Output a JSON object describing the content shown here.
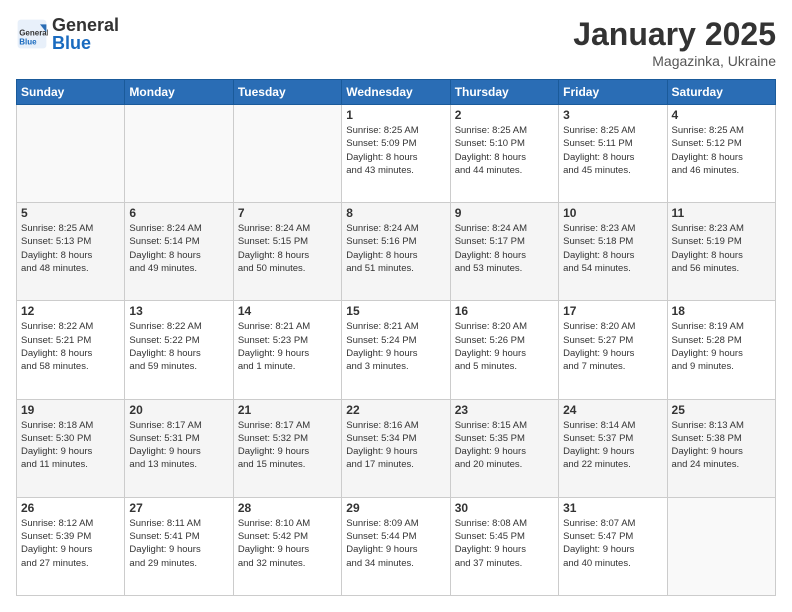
{
  "logo": {
    "general": "General",
    "blue": "Blue"
  },
  "title": "January 2025",
  "location": "Magazinka, Ukraine",
  "days_header": [
    "Sunday",
    "Monday",
    "Tuesday",
    "Wednesday",
    "Thursday",
    "Friday",
    "Saturday"
  ],
  "weeks": [
    [
      {
        "day": "",
        "info": ""
      },
      {
        "day": "",
        "info": ""
      },
      {
        "day": "",
        "info": ""
      },
      {
        "day": "1",
        "info": "Sunrise: 8:25 AM\nSunset: 5:09 PM\nDaylight: 8 hours\nand 43 minutes."
      },
      {
        "day": "2",
        "info": "Sunrise: 8:25 AM\nSunset: 5:10 PM\nDaylight: 8 hours\nand 44 minutes."
      },
      {
        "day": "3",
        "info": "Sunrise: 8:25 AM\nSunset: 5:11 PM\nDaylight: 8 hours\nand 45 minutes."
      },
      {
        "day": "4",
        "info": "Sunrise: 8:25 AM\nSunset: 5:12 PM\nDaylight: 8 hours\nand 46 minutes."
      }
    ],
    [
      {
        "day": "5",
        "info": "Sunrise: 8:25 AM\nSunset: 5:13 PM\nDaylight: 8 hours\nand 48 minutes."
      },
      {
        "day": "6",
        "info": "Sunrise: 8:24 AM\nSunset: 5:14 PM\nDaylight: 8 hours\nand 49 minutes."
      },
      {
        "day": "7",
        "info": "Sunrise: 8:24 AM\nSunset: 5:15 PM\nDaylight: 8 hours\nand 50 minutes."
      },
      {
        "day": "8",
        "info": "Sunrise: 8:24 AM\nSunset: 5:16 PM\nDaylight: 8 hours\nand 51 minutes."
      },
      {
        "day": "9",
        "info": "Sunrise: 8:24 AM\nSunset: 5:17 PM\nDaylight: 8 hours\nand 53 minutes."
      },
      {
        "day": "10",
        "info": "Sunrise: 8:23 AM\nSunset: 5:18 PM\nDaylight: 8 hours\nand 54 minutes."
      },
      {
        "day": "11",
        "info": "Sunrise: 8:23 AM\nSunset: 5:19 PM\nDaylight: 8 hours\nand 56 minutes."
      }
    ],
    [
      {
        "day": "12",
        "info": "Sunrise: 8:22 AM\nSunset: 5:21 PM\nDaylight: 8 hours\nand 58 minutes."
      },
      {
        "day": "13",
        "info": "Sunrise: 8:22 AM\nSunset: 5:22 PM\nDaylight: 8 hours\nand 59 minutes."
      },
      {
        "day": "14",
        "info": "Sunrise: 8:21 AM\nSunset: 5:23 PM\nDaylight: 9 hours\nand 1 minute."
      },
      {
        "day": "15",
        "info": "Sunrise: 8:21 AM\nSunset: 5:24 PM\nDaylight: 9 hours\nand 3 minutes."
      },
      {
        "day": "16",
        "info": "Sunrise: 8:20 AM\nSunset: 5:26 PM\nDaylight: 9 hours\nand 5 minutes."
      },
      {
        "day": "17",
        "info": "Sunrise: 8:20 AM\nSunset: 5:27 PM\nDaylight: 9 hours\nand 7 minutes."
      },
      {
        "day": "18",
        "info": "Sunrise: 8:19 AM\nSunset: 5:28 PM\nDaylight: 9 hours\nand 9 minutes."
      }
    ],
    [
      {
        "day": "19",
        "info": "Sunrise: 8:18 AM\nSunset: 5:30 PM\nDaylight: 9 hours\nand 11 minutes."
      },
      {
        "day": "20",
        "info": "Sunrise: 8:17 AM\nSunset: 5:31 PM\nDaylight: 9 hours\nand 13 minutes."
      },
      {
        "day": "21",
        "info": "Sunrise: 8:17 AM\nSunset: 5:32 PM\nDaylight: 9 hours\nand 15 minutes."
      },
      {
        "day": "22",
        "info": "Sunrise: 8:16 AM\nSunset: 5:34 PM\nDaylight: 9 hours\nand 17 minutes."
      },
      {
        "day": "23",
        "info": "Sunrise: 8:15 AM\nSunset: 5:35 PM\nDaylight: 9 hours\nand 20 minutes."
      },
      {
        "day": "24",
        "info": "Sunrise: 8:14 AM\nSunset: 5:37 PM\nDaylight: 9 hours\nand 22 minutes."
      },
      {
        "day": "25",
        "info": "Sunrise: 8:13 AM\nSunset: 5:38 PM\nDaylight: 9 hours\nand 24 minutes."
      }
    ],
    [
      {
        "day": "26",
        "info": "Sunrise: 8:12 AM\nSunset: 5:39 PM\nDaylight: 9 hours\nand 27 minutes."
      },
      {
        "day": "27",
        "info": "Sunrise: 8:11 AM\nSunset: 5:41 PM\nDaylight: 9 hours\nand 29 minutes."
      },
      {
        "day": "28",
        "info": "Sunrise: 8:10 AM\nSunset: 5:42 PM\nDaylight: 9 hours\nand 32 minutes."
      },
      {
        "day": "29",
        "info": "Sunrise: 8:09 AM\nSunset: 5:44 PM\nDaylight: 9 hours\nand 34 minutes."
      },
      {
        "day": "30",
        "info": "Sunrise: 8:08 AM\nSunset: 5:45 PM\nDaylight: 9 hours\nand 37 minutes."
      },
      {
        "day": "31",
        "info": "Sunrise: 8:07 AM\nSunset: 5:47 PM\nDaylight: 9 hours\nand 40 minutes."
      },
      {
        "day": "",
        "info": ""
      }
    ]
  ]
}
